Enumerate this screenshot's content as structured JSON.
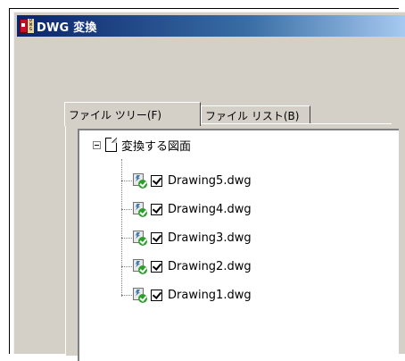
{
  "window": {
    "title": "DWG 変換",
    "icon": "dwg-app-icon"
  },
  "tabs": [
    {
      "label": "ファイル ツリー(F)",
      "active": true
    },
    {
      "label": "ファイル リスト(B)",
      "active": false
    }
  ],
  "tree": {
    "root_label": "変換する図面",
    "root_expanded": true,
    "items": [
      {
        "label": "Drawing5.dwg",
        "checked": true
      },
      {
        "label": "Drawing4.dwg",
        "checked": true
      },
      {
        "label": "Drawing3.dwg",
        "checked": true
      },
      {
        "label": "Drawing2.dwg",
        "checked": true
      },
      {
        "label": "Drawing1.dwg",
        "checked": true
      }
    ]
  },
  "colors": {
    "titlebar_start": "#0a246a",
    "titlebar_end": "#a6caf0",
    "window_bg": "#d4d0c8"
  }
}
